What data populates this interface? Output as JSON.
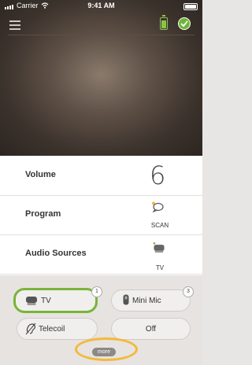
{
  "status_bar": {
    "carrier": "Carrier",
    "time": "9:41 AM"
  },
  "header": {
    "menu_icon": "hamburger-icon",
    "device_battery_icon": "battery-icon",
    "status_icon": "check-circle-icon"
  },
  "controls": {
    "volume": {
      "label": "Volume",
      "value": "6"
    },
    "program": {
      "label": "Program",
      "value": "SCAN"
    },
    "audio_sources": {
      "label": "Audio Sources",
      "value": "TV"
    }
  },
  "sources": [
    {
      "label": "TV",
      "badge": "1",
      "active": true
    },
    {
      "label": "Mini Mic",
      "badge": "3",
      "active": false
    },
    {
      "label": "Telecoil",
      "active": false
    },
    {
      "label": "Off",
      "active": false
    }
  ],
  "more_label": "more",
  "colors": {
    "accent_green": "#79b43b",
    "highlight_orange": "#f4b83a"
  }
}
